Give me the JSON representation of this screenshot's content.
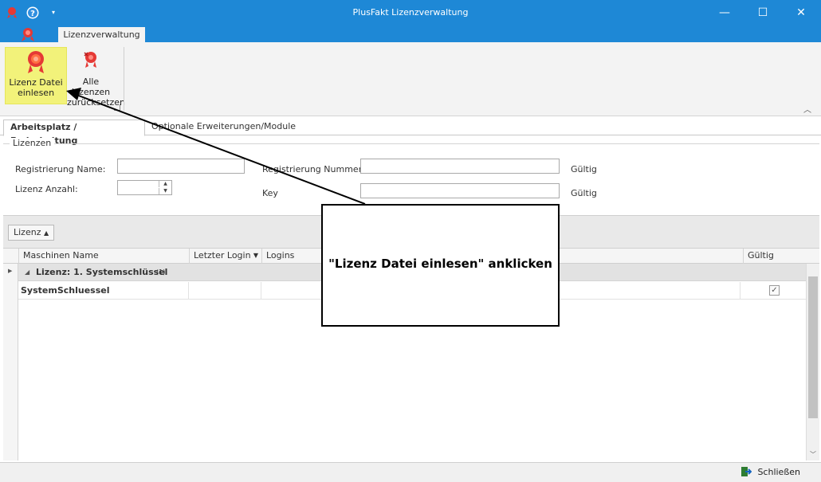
{
  "window": {
    "title": "PlusFakt Lizenzverwaltung"
  },
  "ribbon": {
    "tab": "Lizenzverwaltung",
    "btn_read": [
      "Lizenz Datei",
      "einlesen"
    ],
    "btn_reset": [
      "Alle Lizenzen",
      "zurücksetzen"
    ]
  },
  "page_tabs": [
    "Arbeitsplatz / Freischaltung",
    "Optionale Erweiterungen/Module"
  ],
  "group": {
    "legend": "Lizenzen",
    "reg_name_label": "Registrierung Name:",
    "count_label": "Lizenz Anzahl:",
    "reg_nr_label": "Registrierung Nummer:",
    "key_label": "Key",
    "valid1": "Gültig",
    "valid2": "Gültig"
  },
  "grid": {
    "group_chip": "Lizenz",
    "columns": [
      "Maschinen Name",
      "Letzter Login",
      "Logins",
      "Gültig"
    ],
    "group_row": "Lizenz: 1. Systemschlüssel",
    "group_count": "(1)",
    "row_name": "SystemSchluessel"
  },
  "status": {
    "close": "Schließen"
  },
  "callout": {
    "text": "\"Lizenz Datei einlesen\" anklicken"
  },
  "colors": {
    "titlebar": "#1e88d6",
    "highlight": "#f2f27a"
  }
}
